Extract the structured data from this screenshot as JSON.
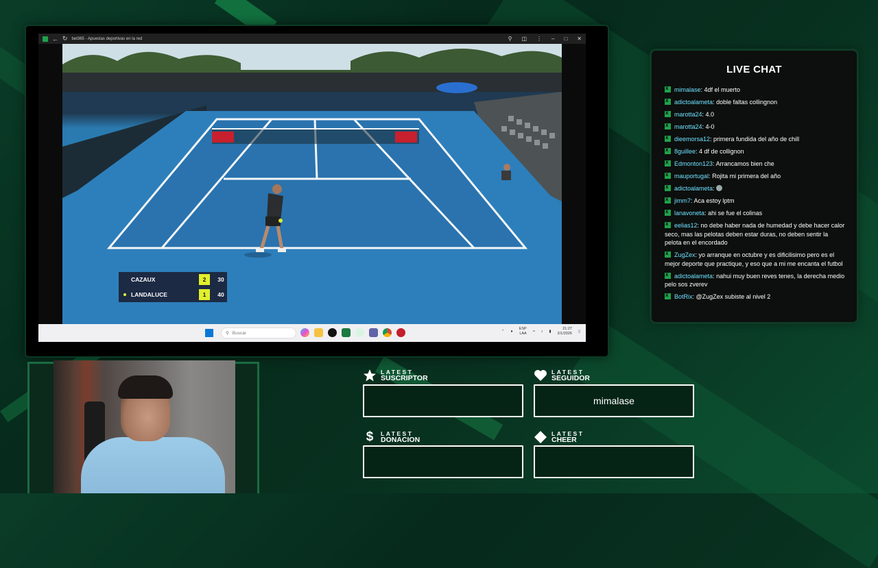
{
  "browser": {
    "tab_title": "bet365 - Apuestas deportivas en la red"
  },
  "scoreboard": {
    "players": [
      {
        "name": "CAZAUX",
        "sets": "2",
        "points": "30",
        "serving": false
      },
      {
        "name": "LANDALUCE",
        "sets": "1",
        "points": "40",
        "serving": true
      }
    ]
  },
  "taskbar": {
    "search_placeholder": "Buscar",
    "language": "ESP",
    "language_sub": "LAA",
    "time": "21:27",
    "date": "2/1/2026"
  },
  "chat": {
    "title": "LIVE CHAT",
    "messages": [
      {
        "user": "mimalase",
        "text": " 4df el muerto"
      },
      {
        "user": "adictoalameta",
        "text": " doble faltas collingnon"
      },
      {
        "user": "marotta24",
        "text": " 4.0"
      },
      {
        "user": "marotta24",
        "text": " 4-0"
      },
      {
        "user": "dieemorsa12",
        "text": " primera fundida del año de chill"
      },
      {
        "user": "8guillee",
        "text": " 4 df de collignon"
      },
      {
        "user": "Edmonton123",
        "text": " Arrancamos bien che"
      },
      {
        "user": "mauportugal",
        "text": " Rojita mi primera del año"
      },
      {
        "user": "adictoalameta",
        "text": " "
      },
      {
        "user": "jimm7",
        "text": " Aca estoy lptm"
      },
      {
        "user": "lanavoneta",
        "text": " ahi se fue el colinas"
      },
      {
        "user": "eelias12",
        "text": " no debe haber nada de humedad y debe hacer calor seco, mas las pelotas deben estar duras, no deben sentir la pelota en el encordado"
      },
      {
        "user": "ZugZex",
        "text": " yo arranque en octubre y es dificilisimo pero es el mejor deporte que practique, y eso que a mi me encanta el futbol"
      },
      {
        "user": "adictoalameta",
        "text": " nahui muy buen reves tenes, la derecha medio pelo sos zverev"
      },
      {
        "user": "BotRix",
        "text": " @ZugZex subiste al nivel 2"
      }
    ]
  },
  "latest": {
    "suscriptor": {
      "small": "LATEST",
      "big": "SUSCRIPTOR",
      "value": ""
    },
    "seguidor": {
      "small": "LATEST",
      "big": "SEGUIDOR",
      "value": "mimalase"
    },
    "donacion": {
      "small": "LATEST",
      "big": "DONACION",
      "value": ""
    },
    "cheer": {
      "small": "LATEST",
      "big": "CHEER",
      "value": ""
    }
  },
  "colors": {
    "accent_green": "#1fa24a",
    "chat_user": "#6fe0ff",
    "background": "#062a1c"
  }
}
